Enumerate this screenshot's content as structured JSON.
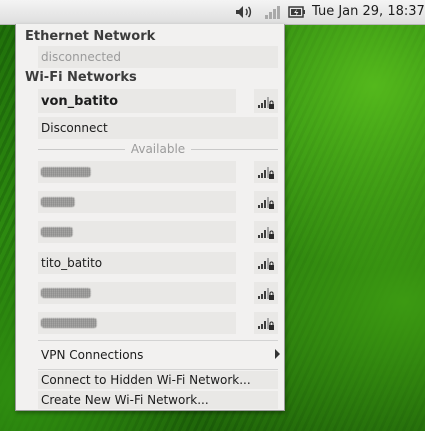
{
  "panel": {
    "clock": "Tue Jan 29, 18:37",
    "icons": [
      "volume-icon",
      "signal-icon",
      "battery-icon"
    ]
  },
  "menu": {
    "ethernet_header": "Ethernet Network",
    "ethernet_status": "disconnected",
    "wifi_header": "Wi-Fi Networks",
    "connected_network": "von_batito",
    "disconnect_label": "Disconnect",
    "available_label": "Available",
    "networks": [
      {
        "ssid": "",
        "obscured": true
      },
      {
        "ssid": "",
        "obscured": true
      },
      {
        "ssid": "",
        "obscured": true
      },
      {
        "ssid": "tito_batito",
        "obscured": false
      },
      {
        "ssid": "",
        "obscured": true
      },
      {
        "ssid": "",
        "obscured": true
      }
    ],
    "vpn_label": "VPN Connections",
    "hidden_label": "Connect to Hidden Wi-Fi Network...",
    "create_label": "Create New Wi-Fi Network..."
  }
}
